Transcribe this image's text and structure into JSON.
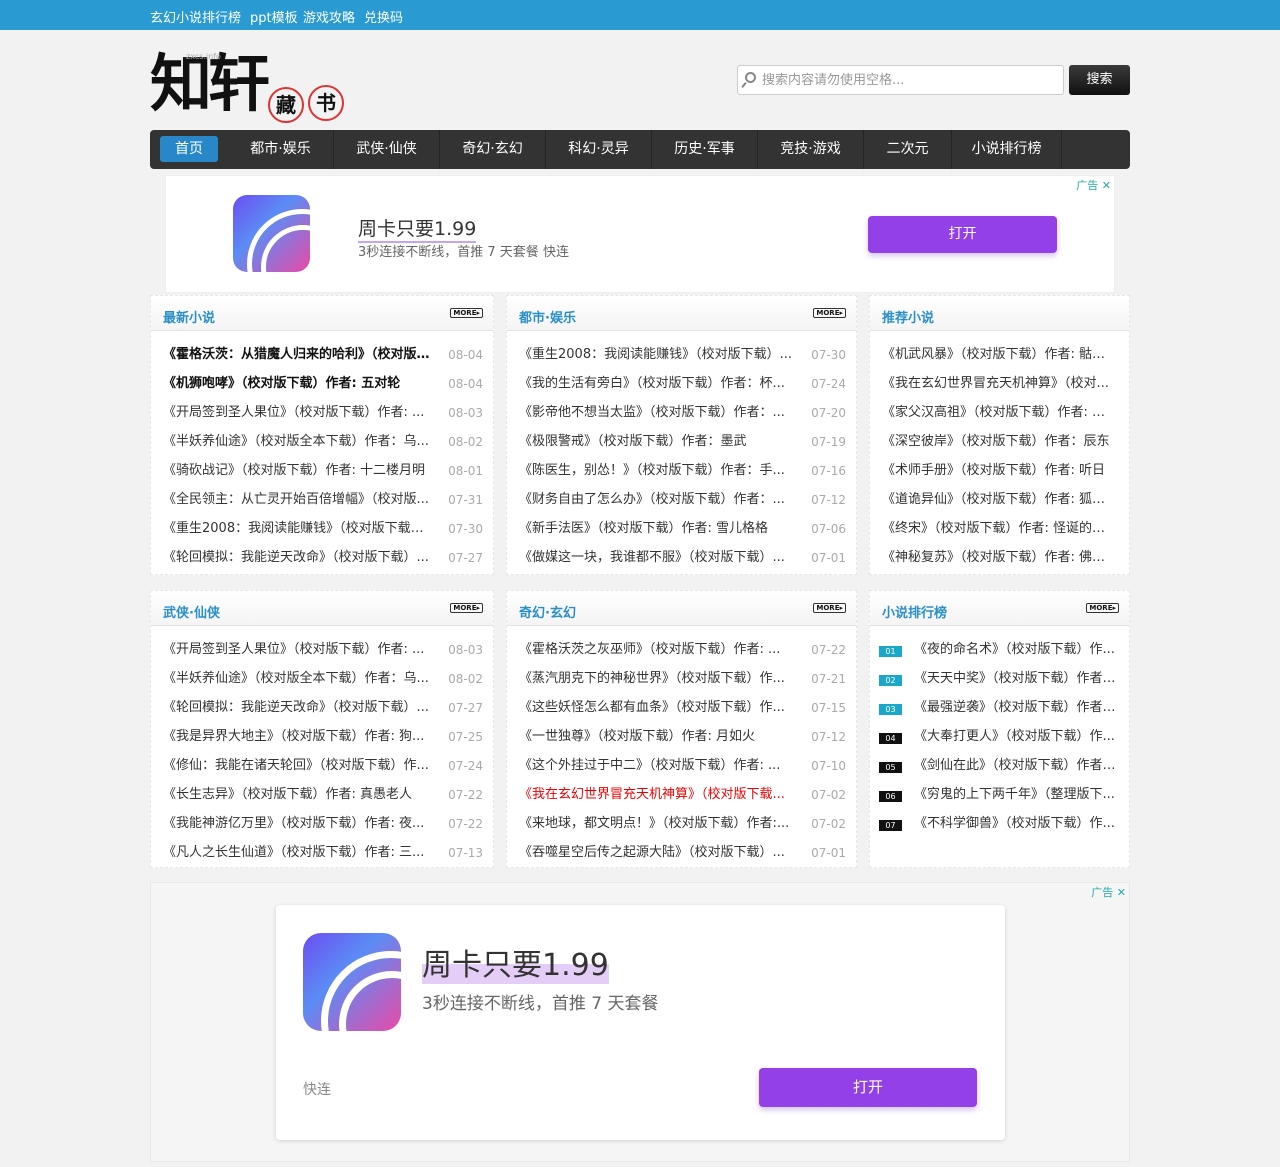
{
  "topbar": {
    "links": [
      "玄幻小说排行榜",
      "ppt模板",
      "游戏攻略",
      "兑换码"
    ]
  },
  "logo": {
    "chars": [
      "知",
      "轩"
    ],
    "seals": [
      "藏",
      "书"
    ],
    "domain": "zxcs.info"
  },
  "search": {
    "placeholder": "搜索内容请勿使用空格...",
    "button": "搜索"
  },
  "nav": {
    "items": [
      "首页",
      "都市·娱乐",
      "武侠·仙侠",
      "奇幻·玄幻",
      "科幻·灵异",
      "历史·军事",
      "竞技·游戏",
      "二次元",
      "小说排行榜"
    ]
  },
  "ad_top": {
    "tag": "广告 ✕",
    "title": "周卡只要1.99",
    "subtitle": "3秒连接不断线，首推 7 天套餐 快连",
    "button": "打开"
  },
  "ad_bottom": {
    "tag": "广告 ✕",
    "title": "周卡只要1.99",
    "subtitle": "3秒连接不断线，首推 7 天套餐",
    "brand": "快连",
    "button": "打开"
  },
  "more_label": "MORE▸",
  "sections": [
    {
      "title": "最新小说",
      "items": [
        {
          "t": "《霍格沃茨：从猎魔人归来的哈利》（校对版下载）",
          "d": "08-04",
          "style": "bold"
        },
        {
          "t": "《机狮咆哮》（校对版下载）作者: 五对轮",
          "d": "08-04",
          "style": "bold"
        },
        {
          "t": "《开局签到圣人果位》（校对版下载）作者: ...",
          "d": "08-03"
        },
        {
          "t": "《半妖养仙途》（校对版全本下载）作者：乌...",
          "d": "08-02"
        },
        {
          "t": "《骑砍战记》（校对版下载）作者: 十二楼月明",
          "d": "08-01"
        },
        {
          "t": "《全民领主：从亡灵开始百倍增幅》（校对版...",
          "d": "07-31"
        },
        {
          "t": "《重生2008：我阅读能赚钱》（校对版下载）...",
          "d": "07-30"
        },
        {
          "t": "《轮回模拟：我能逆天改命》（校对版下载）...",
          "d": "07-27"
        }
      ]
    },
    {
      "title": "都市·娱乐",
      "items": [
        {
          "t": "《重生2008：我阅读能赚钱》（校对版下载）...",
          "d": "07-30"
        },
        {
          "t": "《我的生活有旁白》（校对版下载）作者：杯...",
          "d": "07-24"
        },
        {
          "t": "《影帝他不想当太监》（校对版下载）作者：...",
          "d": "07-20"
        },
        {
          "t": "《极限警戒》（校对版下载）作者：墨武",
          "d": "07-19"
        },
        {
          "t": "《陈医生，别怂！》（校对版下载）作者：手...",
          "d": "07-16"
        },
        {
          "t": "《财务自由了怎么办》（校对版下载）作者：...",
          "d": "07-12"
        },
        {
          "t": "《新手法医》（校对版下载）作者: 雪儿格格",
          "d": "07-06"
        },
        {
          "t": "《做媒这一块，我谁都不服》（校对版下载）...",
          "d": "07-01"
        }
      ]
    },
    {
      "title": "推荐小说",
      "items": [
        {
          "t": "《机武风暴》（校对版下载）作者: 骷髅..."
        },
        {
          "t": "《我在玄幻世界冒充天机神算》（校对..."
        },
        {
          "t": "《家父汉高祖》（校对版下载）作者: 历..."
        },
        {
          "t": "《深空彼岸》（校对版下载）作者：辰东"
        },
        {
          "t": "《术师手册》（校对版下载）作者: 听日"
        },
        {
          "t": "《道诡异仙》（校对版下载）作者: 狐尾..."
        },
        {
          "t": "《终宋》（校对版下载）作者: 怪诞的表哥"
        },
        {
          "t": "《神秘复苏》（校对版下载）作者: 佛前..."
        }
      ]
    },
    {
      "title": "武侠·仙侠",
      "items": [
        {
          "t": "《开局签到圣人果位》（校对版下载）作者: ...",
          "d": "08-03"
        },
        {
          "t": "《半妖养仙途》（校对版全本下载）作者：乌...",
          "d": "08-02"
        },
        {
          "t": "《轮回模拟：我能逆天改命》（校对版下载）...",
          "d": "07-27"
        },
        {
          "t": "《我是异界大地主》（校对版下载）作者: 狗...",
          "d": "07-25"
        },
        {
          "t": "《修仙：我能在诸天轮回》（校对版下载）作...",
          "d": "07-24"
        },
        {
          "t": "《长生志异》（校对版下载）作者: 真愚老人",
          "d": "07-22"
        },
        {
          "t": "《我能神游亿万里》（校对版下载）作者: 夜...",
          "d": "07-22"
        },
        {
          "t": "《凡人之长生仙道》（校对版下载）作者: 三...",
          "d": "07-13"
        }
      ]
    },
    {
      "title": "奇幻·玄幻",
      "items": [
        {
          "t": "《霍格沃茨之灰巫师》（校对版下载）作者: ...",
          "d": "07-22"
        },
        {
          "t": "《蒸汽朋克下的神秘世界》（校对版下载）作...",
          "d": "07-21"
        },
        {
          "t": "《这些妖怪怎么都有血条》（校对版下载）作...",
          "d": "07-15"
        },
        {
          "t": "《一世独尊》（校对版下载）作者: 月如火",
          "d": "07-12"
        },
        {
          "t": "《这个外挂过于中二》（校对版下载）作者: ...",
          "d": "07-10"
        },
        {
          "t": "《我在玄幻世界冒充天机神算》（校对版下载...",
          "d": "07-02",
          "style": "red"
        },
        {
          "t": "《来地球，都文明点！》（校对版下载）作者:...",
          "d": "07-02"
        },
        {
          "t": "《吞噬星空后传之起源大陆》（校对版下载）...",
          "d": "07-01"
        }
      ]
    },
    {
      "title": "小说排行榜",
      "items": [
        {
          "r": "01",
          "t": "《夜的命名术》（校对版下载）作..."
        },
        {
          "r": "02",
          "t": "《天天中奖》（校对版下载）作者: ..."
        },
        {
          "r": "03",
          "t": "《最强逆袭》（校对版下载）作者: ..."
        },
        {
          "r": "04",
          "t": "《大奉打更人》（校对版下载）作..."
        },
        {
          "r": "05",
          "t": "《剑仙在此》（校对版下载）作者: ..."
        },
        {
          "r": "06",
          "t": "《穷鬼的上下两千年》（整理版下..."
        },
        {
          "r": "07",
          "t": "《不科学御兽》（校对版下载）作..."
        }
      ]
    }
  ]
}
